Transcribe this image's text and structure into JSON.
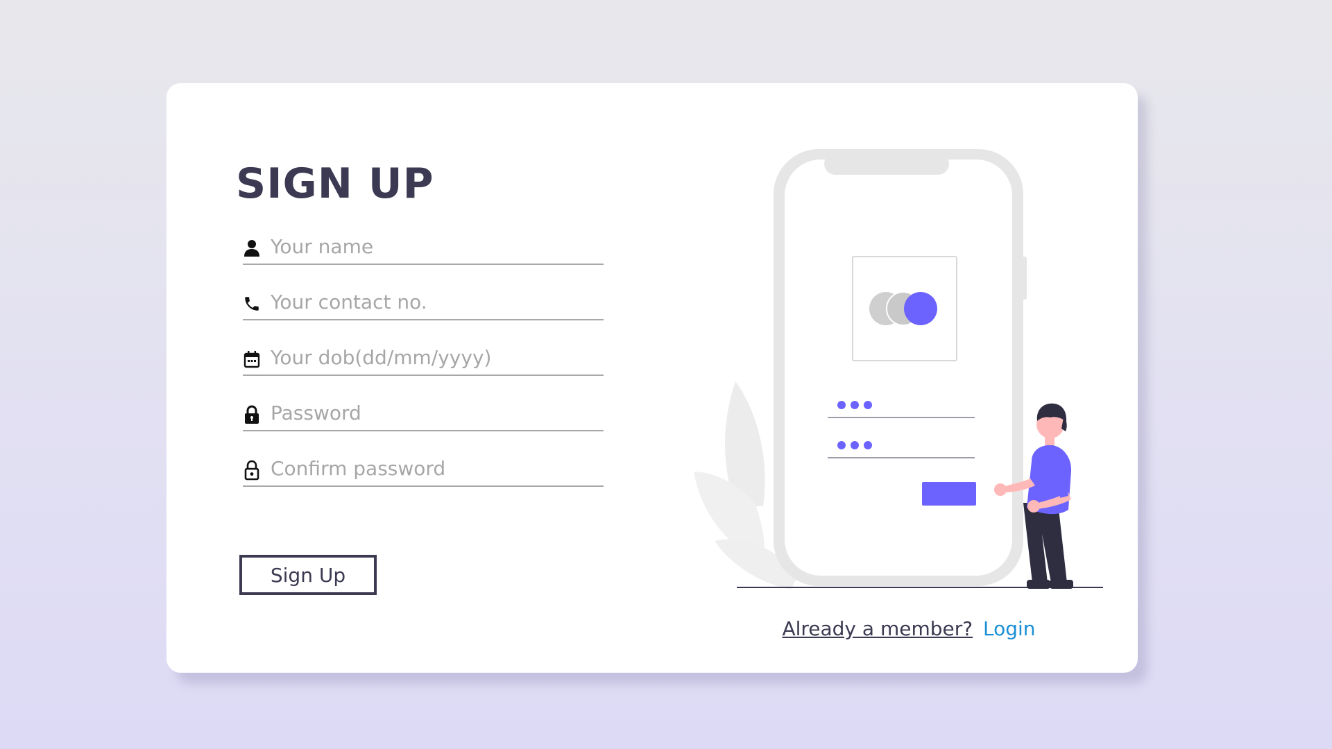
{
  "form": {
    "title": "SIGN UP",
    "fields": [
      {
        "icon": "user-icon",
        "placeholder": "Your name"
      },
      {
        "icon": "phone-icon",
        "placeholder": "Your contact no."
      },
      {
        "icon": "calendar-icon",
        "placeholder": "Your dob(dd/mm/yyyy)"
      },
      {
        "icon": "lock-icon",
        "placeholder": "Password"
      },
      {
        "icon": "lock-outline-icon",
        "placeholder": "Confirm password"
      }
    ],
    "submit_label": "Sign Up"
  },
  "footer": {
    "member_text": "Already a member?",
    "login_label": "Login"
  },
  "colors": {
    "heading": "#3b3a52",
    "accent": "#6c63ff",
    "link": "#1a8fd6"
  }
}
